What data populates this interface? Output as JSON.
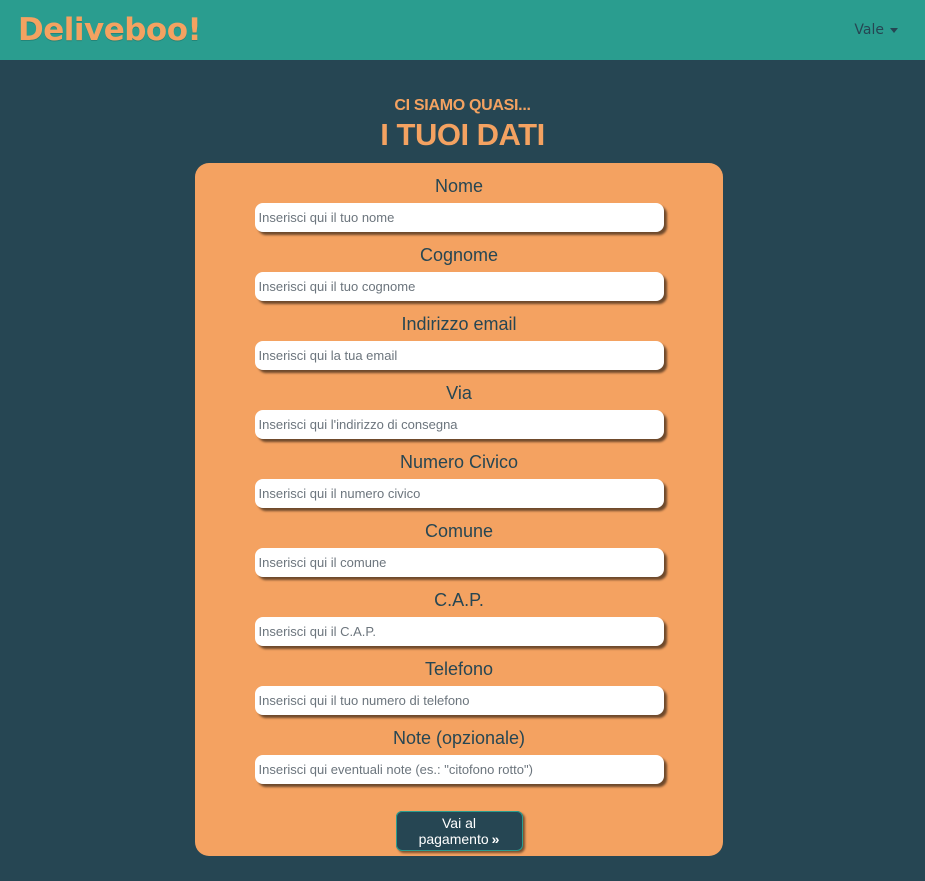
{
  "navbar": {
    "brand": "Deliveboo!",
    "user": "Vale"
  },
  "heading": {
    "subtitle": "Ci siamo quasi...",
    "title": "I tuoi dati"
  },
  "form": {
    "fields": [
      {
        "label": "Nome",
        "placeholder": "Inserisci qui il tuo nome"
      },
      {
        "label": "Cognome",
        "placeholder": "Inserisci qui il tuo cognome"
      },
      {
        "label": "Indirizzo email",
        "placeholder": "Inserisci qui la tua email"
      },
      {
        "label": "Via",
        "placeholder": "Inserisci qui l'indirizzo di consegna"
      },
      {
        "label": "Numero Civico",
        "placeholder": "Inserisci qui il numero civico"
      },
      {
        "label": "Comune",
        "placeholder": "Inserisci qui il comune"
      },
      {
        "label": "C.A.P.",
        "placeholder": "Inserisci qui il C.A.P."
      },
      {
        "label": "Telefono",
        "placeholder": "Inserisci qui il tuo numero di telefono"
      },
      {
        "label": "Note (opzionale)",
        "placeholder": "Inserisci qui eventuali note (es.: \"citofono rotto\")"
      }
    ],
    "submit_label": "Vai al pagamento",
    "submit_icon": "double-chevron-right-icon"
  },
  "colors": {
    "background": "#264653",
    "navbar": "#2a9d8f",
    "accent": "#f4a261"
  }
}
